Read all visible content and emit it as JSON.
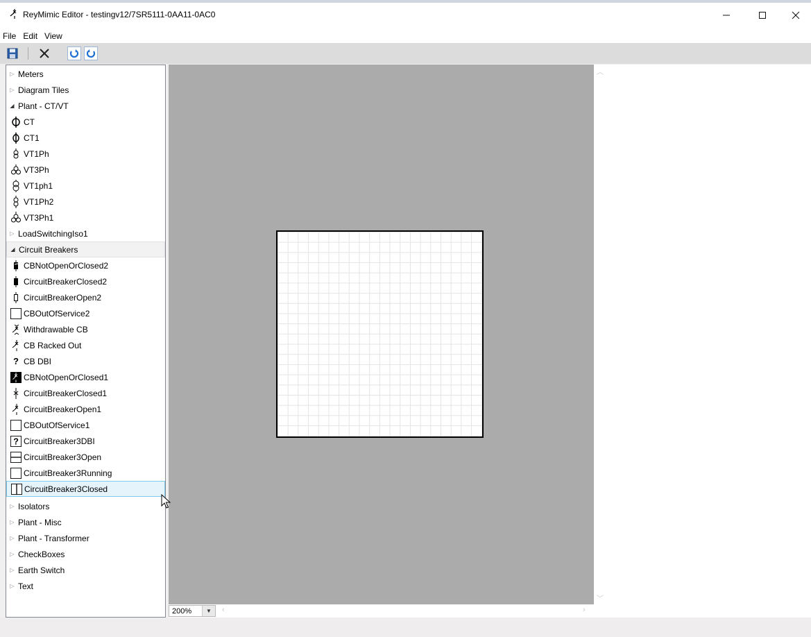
{
  "window": {
    "title": "ReyMimic Editor - testingv12/7SR5111-0AA11-0AC0",
    "app_icon": "circuit-breaker-open-icon",
    "controls": [
      "minimize-icon",
      "maximize-icon",
      "close-icon"
    ]
  },
  "menu": [
    "File",
    "Edit",
    "View"
  ],
  "toolbar": {
    "buttons": [
      {
        "name": "save",
        "icon": "floppy-disk-icon"
      },
      {
        "name": "delete",
        "icon": "x-icon"
      },
      {
        "name": "undo",
        "icon": "undo-icon"
      },
      {
        "name": "redo",
        "icon": "redo-icon"
      }
    ]
  },
  "tree": {
    "items": [
      {
        "type": "group",
        "label": "Meters",
        "expanded": false
      },
      {
        "type": "group",
        "label": "Diagram Tiles",
        "expanded": false
      },
      {
        "type": "group",
        "label": "Plant - CT/VT",
        "expanded": true
      },
      {
        "type": "item",
        "label": "CT",
        "icon": "ct-icon"
      },
      {
        "type": "item",
        "label": "CT1",
        "icon": "ct1-icon"
      },
      {
        "type": "item",
        "label": "VT1Ph",
        "icon": "vt-single-phase-icon"
      },
      {
        "type": "item",
        "label": "VT3Ph",
        "icon": "vt-three-phase-icon"
      },
      {
        "type": "item",
        "label": "VT1ph1",
        "icon": "vt-single-phase-icon"
      },
      {
        "type": "item",
        "label": "VT1Ph2",
        "icon": "vt-single-phase-icon"
      },
      {
        "type": "item",
        "label": "VT3Ph1",
        "icon": "vt-three-phase-icon"
      },
      {
        "type": "group",
        "label": "LoadSwitchingIso1",
        "expanded": false
      },
      {
        "type": "group",
        "label": "Circuit Breakers",
        "expanded": true
      },
      {
        "type": "item",
        "label": "CBNotOpenOrClosed2",
        "icon": "cb-not-open-or-closed-icon"
      },
      {
        "type": "item",
        "label": "CircuitBreakerClosed2",
        "icon": "cb-closed-icon"
      },
      {
        "type": "item",
        "label": "CircuitBreakerOpen2",
        "icon": "cb-open-icon"
      },
      {
        "type": "item",
        "label": "CBOutOfService2",
        "icon": "empty-box-icon"
      },
      {
        "type": "item",
        "label": "Withdrawable CB",
        "icon": "withdrawable-cb-icon"
      },
      {
        "type": "item",
        "label": "CB Racked Out",
        "icon": "cb-racked-out-icon"
      },
      {
        "type": "item",
        "label": "CB DBI",
        "icon": "question-mark-icon"
      },
      {
        "type": "item",
        "label": "CBNotOpenOrClosed1",
        "icon": "cb-not-open-or-closed-filled-icon"
      },
      {
        "type": "item",
        "label": "CircuitBreakerClosed1",
        "icon": "cb-closed-x-icon"
      },
      {
        "type": "item",
        "label": "CircuitBreakerOpen1",
        "icon": "cb-open-x-icon"
      },
      {
        "type": "item",
        "label": "CBOutOfService1",
        "icon": "empty-box-icon"
      },
      {
        "type": "item",
        "label": "CircuitBreaker3DBI",
        "icon": "boxed-question-icon"
      },
      {
        "type": "item",
        "label": "CircuitBreaker3Open",
        "icon": "boxed-horizontal-bar-icon"
      },
      {
        "type": "item",
        "label": "CircuitBreaker3Running",
        "icon": "empty-box-icon"
      },
      {
        "type": "item",
        "label": "CircuitBreaker3Closed",
        "icon": "boxed-vertical-bar-icon",
        "selected": true
      },
      {
        "type": "group",
        "label": "Isolators",
        "expanded": false
      },
      {
        "type": "group",
        "label": "Plant - Misc",
        "expanded": false
      },
      {
        "type": "group",
        "label": "Plant - Transformer",
        "expanded": false
      },
      {
        "type": "group",
        "label": "CheckBoxes",
        "expanded": false
      },
      {
        "type": "group",
        "label": "Earth Switch",
        "expanded": false
      },
      {
        "type": "group",
        "label": "Text",
        "expanded": false
      }
    ]
  },
  "canvas": {
    "zoom": "200%",
    "background_color": "#ababab"
  }
}
